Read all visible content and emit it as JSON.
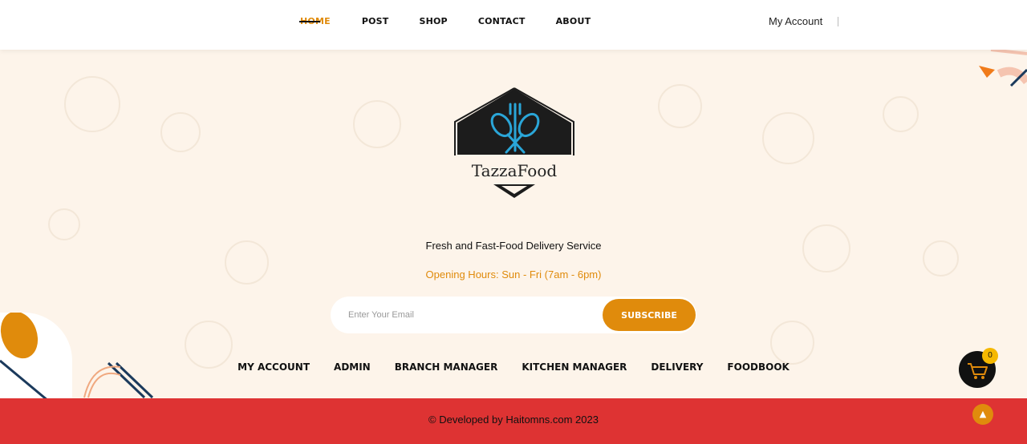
{
  "nav": {
    "items": [
      {
        "label": "HOME",
        "active": true
      },
      {
        "label": "POST"
      },
      {
        "label": "SHOP"
      },
      {
        "label": "CONTACT"
      },
      {
        "label": "ABOUT"
      }
    ],
    "account_label": "My Account"
  },
  "brand": {
    "name": "TazzaFood",
    "tagline": "Fresh and Fast-Food Delivery Service",
    "hours": "Opening Hours: Sun - Fri (7am - 6pm)"
  },
  "subscribe": {
    "placeholder": "Enter Your Email",
    "button_label": "SUBSCRIBE"
  },
  "footer_links": [
    "MY ACCOUNT",
    "ADMIN",
    "BRANCH MANAGER",
    "KITCHEN MANAGER",
    "DELIVERY",
    "FOODBOOK"
  ],
  "copyright": "© Developed by Haitomns.com 2023",
  "cart": {
    "count": "0",
    "icon": "cart-icon"
  },
  "colors": {
    "accent": "#e08b0c",
    "footer": "#de3333",
    "background": "#fdf4ea"
  }
}
